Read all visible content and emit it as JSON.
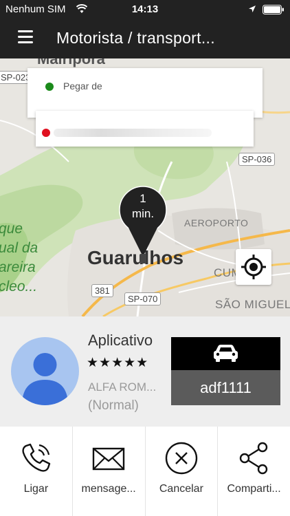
{
  "status_bar": {
    "carrier": "Nenhum SIM",
    "time": "14:13"
  },
  "app_bar": {
    "title": "Motorista / transport..."
  },
  "map": {
    "labels": {
      "top_city": "Mairiporã",
      "city": "Guarulhos",
      "aeroporto": "AEROPORTO",
      "cumbica": "CUMBICA",
      "sao_miguel": "SÃO MIGUEL",
      "park_1": "que",
      "park_2": "ual da",
      "park_3": "areira",
      "park_4": "cleo..."
    },
    "roads": {
      "sp023": "SP-023",
      "sp036": "SP-036",
      "r381": "381",
      "sp070": "SP-070"
    },
    "pickup_label": "Pegar de",
    "eta": {
      "value": "1",
      "unit": "min."
    }
  },
  "driver": {
    "name": "Aplicativo",
    "rating_stars": "★★★★★",
    "car": "ALFA ROM...",
    "category": "(Normal)",
    "plate": "adf1111"
  },
  "actions": [
    {
      "label": "Ligar",
      "icon": "phone-icon"
    },
    {
      "label": "mensage...",
      "icon": "mail-icon"
    },
    {
      "label": "Cancelar",
      "icon": "cancel-icon"
    },
    {
      "label": "Comparti...",
      "icon": "share-icon"
    }
  ],
  "colors": {
    "bar": "#222222",
    "pickup_dot": "#1b8a1b",
    "dest_dot": "#e01020",
    "plate_top": "#000000",
    "plate_bottom": "#5b5b5b"
  }
}
